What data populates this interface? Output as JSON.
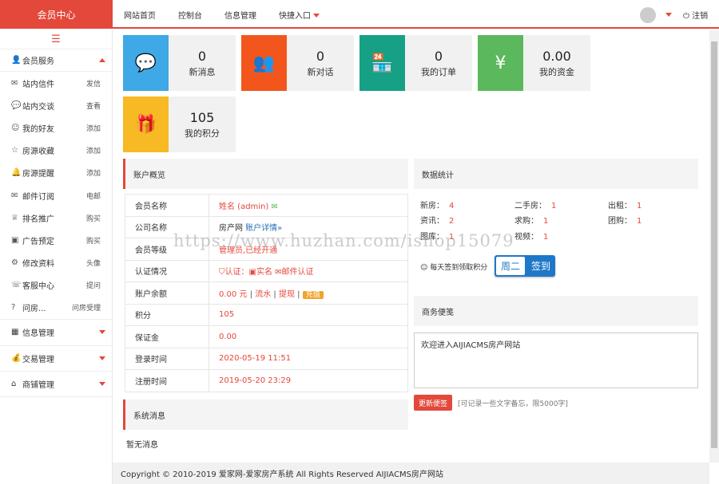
{
  "header": {
    "brand": "会员中心",
    "nav": [
      "网站首页",
      "控制台",
      "信息管理",
      "快捷入口"
    ],
    "logout": "注销",
    "logout_icon": "power-icon",
    "accent": "#e3483b"
  },
  "sidebar": {
    "toggle_icon": "list-icon",
    "group1": {
      "label": "会员服务",
      "icon": "user-icon"
    },
    "items": [
      {
        "label": "站内信件",
        "icon": "mail-icon",
        "action": "发信"
      },
      {
        "label": "站内交谈",
        "icon": "chat-icon",
        "action": "查看"
      },
      {
        "label": "我的好友",
        "icon": "user-icon",
        "action": "添加"
      },
      {
        "label": "房源收藏",
        "icon": "star-icon",
        "action": "添加"
      },
      {
        "label": "房源提醒",
        "icon": "bell-icon",
        "action": "添加"
      },
      {
        "label": "邮件订阅",
        "icon": "envelope-icon",
        "action": "电邮"
      },
      {
        "label": "排名推广",
        "icon": "trophy-icon",
        "action": "购买"
      },
      {
        "label": "广告预定",
        "icon": "ad-icon",
        "action": "购买"
      },
      {
        "label": "修改资料",
        "icon": "settings-icon",
        "action": "头像"
      },
      {
        "label": "客服中心",
        "icon": "headset-icon",
        "action": "提问"
      },
      {
        "label": "问房...",
        "icon": "question-icon",
        "action": "问房受理"
      }
    ],
    "groups": [
      {
        "label": "信息管理",
        "icon": "grid-icon"
      },
      {
        "label": "交易管理",
        "icon": "moneybag-icon"
      },
      {
        "label": "商铺管理",
        "icon": "home-icon"
      }
    ]
  },
  "stats": [
    {
      "value": "0",
      "label": "新消息",
      "color": "#3fa8e6",
      "icon": "chat-bubble-icon"
    },
    {
      "value": "0",
      "label": "新对话",
      "color": "#f2561d",
      "icon": "people-icon"
    },
    {
      "value": "0",
      "label": "我的订单",
      "color": "#16a085",
      "icon": "shop-icon"
    },
    {
      "value": "0.00",
      "label": "我的资金",
      "color": "#5cb85c",
      "icon": "money-bag-icon"
    },
    {
      "value": "105",
      "label": "我的积分",
      "color": "#f7b924",
      "icon": "gift-icon"
    }
  ],
  "account": {
    "title": "账户概览",
    "rows": {
      "name_k": "会员名称",
      "name_v": "姓名 (admin)",
      "company_k": "公司名称",
      "company_v": "房产网",
      "company_link": "账户详情»",
      "level_k": "会员等级",
      "level_v": "管理员,已经开通",
      "auth_k": "认证情况",
      "auth_1": "认证：",
      "auth_2": "实名",
      "auth_3": "邮件认证",
      "balance_k": "账户余额",
      "balance_v": "0.00 元",
      "balance_l1": "流水",
      "balance_l2": "提现",
      "balance_btn": "充值",
      "points_k": "积分",
      "points_v": "105",
      "deposit_k": "保证金",
      "deposit_v": "0.00",
      "login_k": "登录时间",
      "login_v": "2020-05-19 11:51",
      "reg_k": "注册时间",
      "reg_v": "2019-05-20 23:29"
    }
  },
  "data_stats": {
    "title": "数据统计",
    "items": [
      {
        "label": "新房：",
        "value": "4"
      },
      {
        "label": "二手房：",
        "value": "1"
      },
      {
        "label": "出租：",
        "value": "1"
      },
      {
        "label": "资讯：",
        "value": "2"
      },
      {
        "label": "求购：",
        "value": "1"
      },
      {
        "label": "团购：",
        "value": "1"
      },
      {
        "label": "图库：",
        "value": "1"
      },
      {
        "label": "视频：",
        "value": "1"
      }
    ],
    "checkin_label": "每天签到领取积分",
    "checkin_day": "周二",
    "checkin_btn": "签到"
  },
  "notes": {
    "title": "商务便笺",
    "content": "欢迎进入AIJIACMS房产网站",
    "button": "更新便签",
    "hint": "[可记录一些文字备忘，限5000字]"
  },
  "system": {
    "title": "系统消息",
    "empty": "暂无消息"
  },
  "footer": "Copyright © 2010-2019 爱家网-爱家房产系统 All Rights Reserved AIJIACMS房产网站",
  "watermark": "https://www.huzhan.com/ishop15079"
}
